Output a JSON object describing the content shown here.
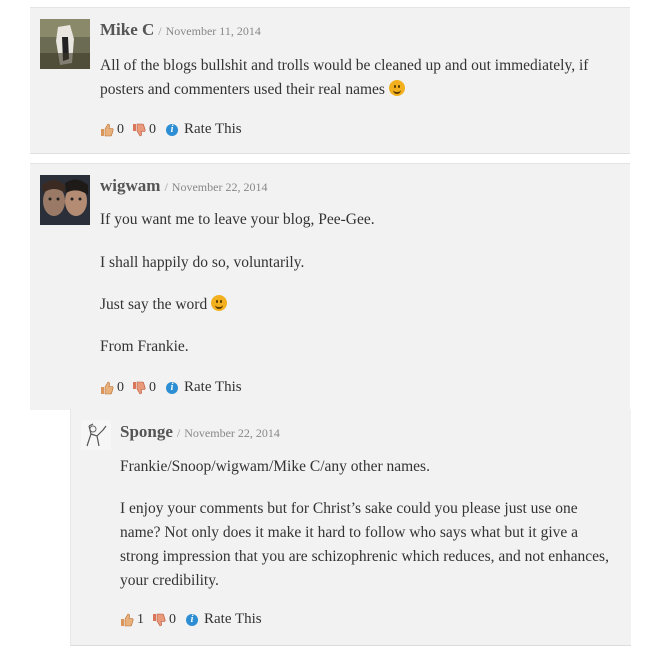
{
  "comments": [
    {
      "author": "Mike C",
      "sep": "/",
      "date": "November 11, 2014",
      "paragraphs": [
        "All of the blogs bullshit and trolls would be cleaned up and out immediately, if",
        "posters and commenters used their real names"
      ],
      "likes": "0",
      "dislikes": "0",
      "rate": "Rate This"
    },
    {
      "author": "wigwam",
      "sep": "/",
      "date": "November 22, 2014",
      "paragraphs": [
        "If you want me to leave your blog, Pee-Gee.",
        "I shall happily do so, voluntarily.",
        "Just say the word",
        "From Frankie."
      ],
      "likes": "0",
      "dislikes": "0",
      "rate": "Rate This"
    },
    {
      "author": "Sponge",
      "sep": "/",
      "date": "November 22, 2014",
      "paragraphs": [
        "Frankie/Snoop/wigwam/Mike C/any other names.",
        "I enjoy your comments but for Christ’s sake could you please just use one name? Not only does it make it hard to follow who says what but it give a strong impression that you are schizophrenic which reduces, and not enhances, your credibility."
      ],
      "likes": "1",
      "dislikes": "0",
      "rate": "Rate This"
    }
  ],
  "icons": {
    "thumbs_up": "thumbs-up-icon",
    "thumbs_down": "thumbs-down-icon",
    "info": "info-icon",
    "smiley": "smiley-icon"
  },
  "colors": {
    "info_blue": "#2e8ed4",
    "smiley": "#f2b01e",
    "thumb": "#d9955a"
  }
}
